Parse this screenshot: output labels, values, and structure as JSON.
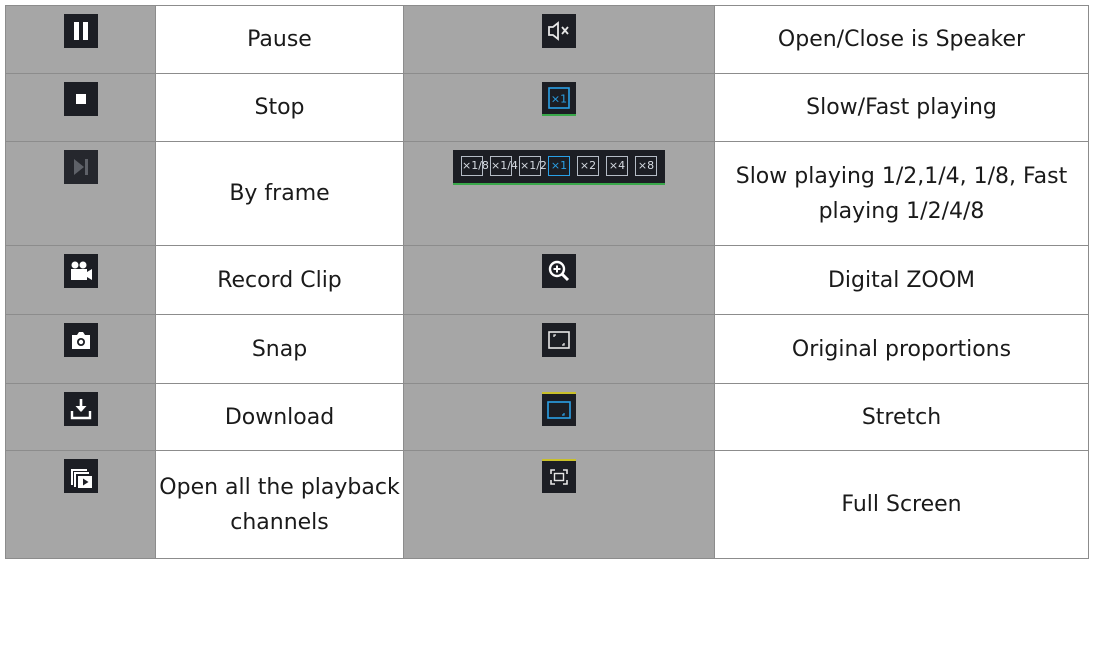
{
  "rows": [
    {
      "left_icon": "pause-icon",
      "left_label": "Pause",
      "right_icon": "speaker-mute-icon",
      "right_label": "Open/Close is Speaker"
    },
    {
      "left_icon": "stop-icon",
      "left_label": "Stop",
      "right_icon": "speed-x1-icon",
      "right_label": "Slow/Fast playing"
    },
    {
      "left_icon": "frame-step-icon",
      "left_label": "By frame",
      "right_icon": "speed-selector-icon",
      "right_label": "Slow playing 1/2,1/4, 1/8, Fast playing 1/2/4/8"
    },
    {
      "left_icon": "record-clip-icon",
      "left_label": "Record Clip",
      "right_icon": "zoom-in-icon",
      "right_label": "Digital ZOOM"
    },
    {
      "left_icon": "camera-icon",
      "left_label": "Snap",
      "right_icon": "original-proportions-icon",
      "right_label": "Original proportions"
    },
    {
      "left_icon": "download-icon",
      "left_label": "Download",
      "right_icon": "stretch-icon",
      "right_label": "Stretch"
    },
    {
      "left_icon": "open-all-channels-icon",
      "left_label": "Open all the playback channels",
      "right_icon": "fullscreen-icon",
      "right_label": "Full Screen"
    }
  ],
  "speed_options": [
    "×1/8",
    "×1/4",
    "×1/2",
    "×1",
    "×2",
    "×4",
    "×8"
  ],
  "speed_selected": "×1",
  "colors": {
    "icon_cell_bg": "#a6a6a6",
    "icon_bg": "#1c1e24",
    "accent_blue": "#2aa0e6",
    "accent_green": "#39a84a"
  }
}
